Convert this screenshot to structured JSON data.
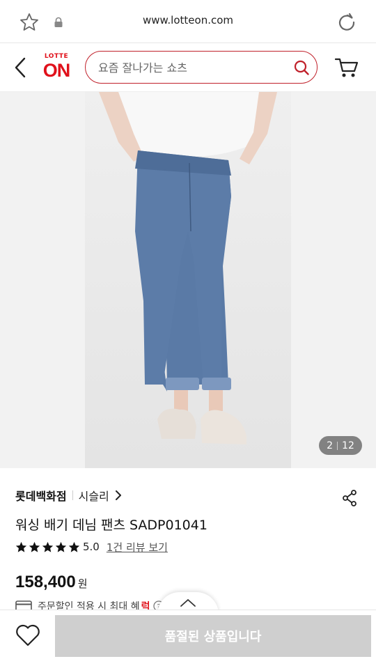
{
  "browser": {
    "url": "www.lotteon.com",
    "icons": [
      "star-icon",
      "lock-icon",
      "reload-icon"
    ]
  },
  "header": {
    "logo_top": "LOTTE",
    "logo_main": "ON",
    "search_placeholder": "요즘 잘나가는 쇼츠",
    "accent_color": "#e0111b"
  },
  "gallery": {
    "current": "2",
    "total": "12"
  },
  "product": {
    "store": "롯데백화점",
    "brand": "시슬리",
    "title": "워싱 배기 데님 팬츠 SADP01041",
    "rating": "5.0",
    "rating_stars": 5,
    "review_link": "1건 리뷰 보기",
    "price": "158,400",
    "currency": "원",
    "benefit_text": "주문할인 적용 시 최대 혜",
    "benefit_highlight": "럭"
  },
  "bottom": {
    "soldout_label": "품절된 상품입니다"
  }
}
